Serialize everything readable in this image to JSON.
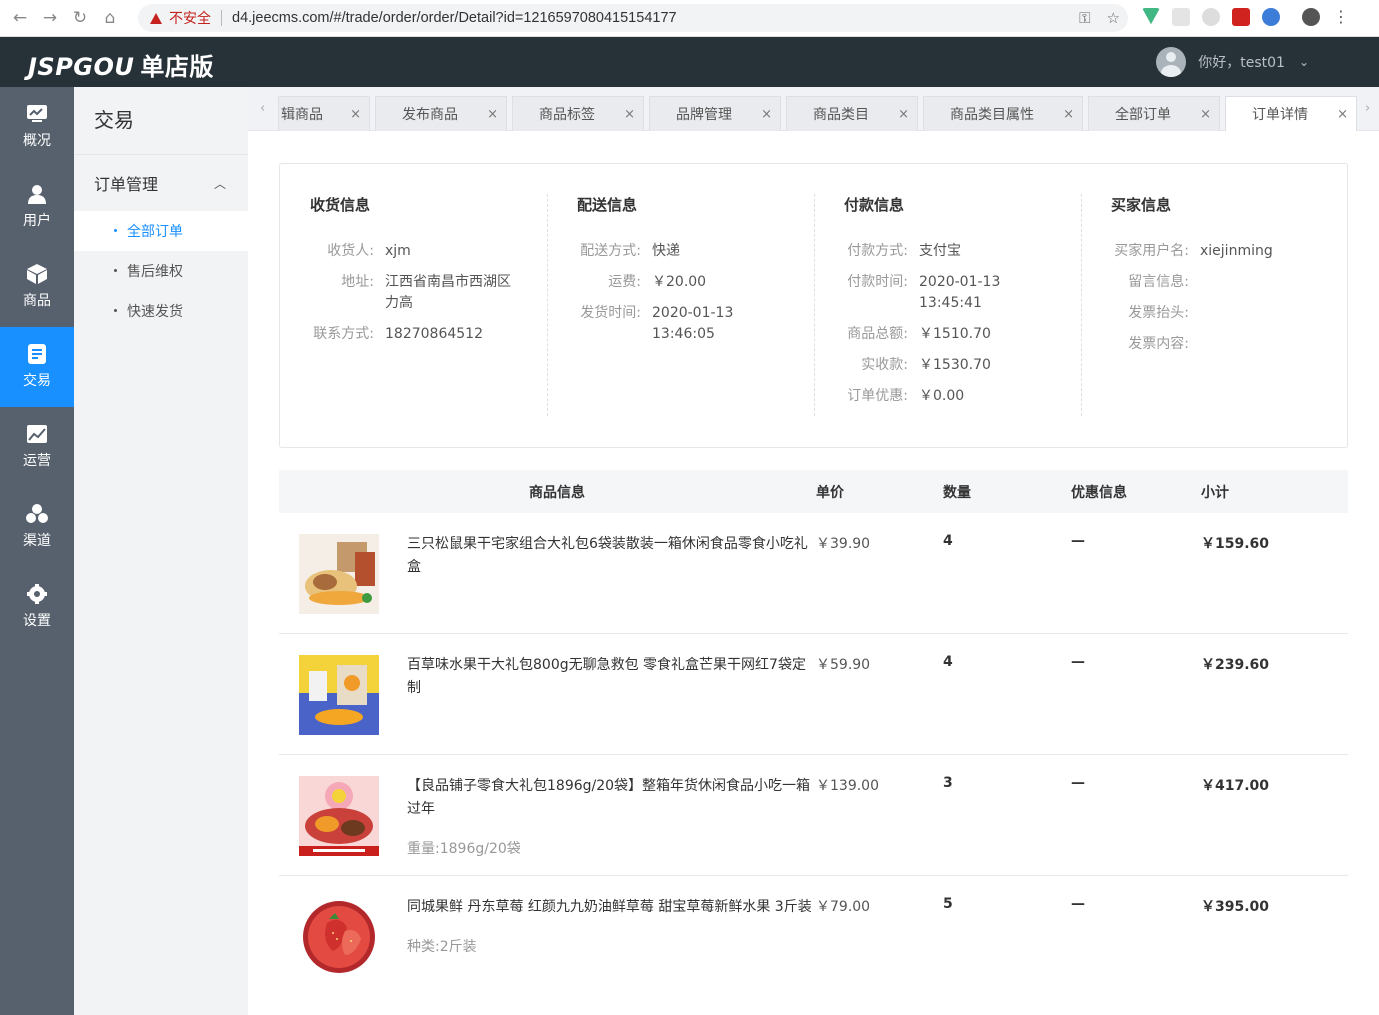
{
  "browser": {
    "insecure_label": "不安全",
    "url": "d4.jeecms.com/#/trade/order/order/Detail?id=1216597080415154177"
  },
  "header": {
    "logo": "JSPGOU",
    "logo_cn": "单店版",
    "greeting": "你好，test01"
  },
  "mainnav": [
    {
      "label": "概况",
      "icon": "dashboard-icon"
    },
    {
      "label": "用户",
      "icon": "user-icon"
    },
    {
      "label": "商品",
      "icon": "cube-icon"
    },
    {
      "label": "交易",
      "icon": "document-icon"
    },
    {
      "label": "运营",
      "icon": "chart-icon"
    },
    {
      "label": "渠道",
      "icon": "channels-icon"
    },
    {
      "label": "设置",
      "icon": "gear-icon"
    }
  ],
  "subnav": {
    "title": "交易",
    "group": "订单管理",
    "items": [
      "全部订单",
      "售后维权",
      "快速发货"
    ]
  },
  "tabs": [
    "辑商品",
    "发布商品",
    "商品标签",
    "品牌管理",
    "商品类目",
    "商品类目属性",
    "全部订单",
    "订单详情"
  ],
  "info": {
    "receive": {
      "title": "收货信息",
      "receiver_label": "收货人:",
      "receiver": "xjm",
      "address_label": "地址:",
      "address_line1": "江西省南昌市西湖区",
      "address_line2": "力高",
      "contact_label": "联系方式:",
      "contact": "18270864512"
    },
    "delivery": {
      "title": "配送信息",
      "method_label": "配送方式:",
      "method": "快递",
      "fee_label": "运费:",
      "fee": "￥20.00",
      "time_label": "发货时间:",
      "date": "2020-01-13",
      "time": "13:46:05"
    },
    "payment": {
      "title": "付款信息",
      "method_label": "付款方式:",
      "method": "支付宝",
      "time_label": "付款时间:",
      "date": "2020-01-13",
      "time": "13:45:41",
      "total_label": "商品总额:",
      "total": "￥1510.70",
      "paid_label": "实收款:",
      "paid": "￥1530.70",
      "discount_label": "订单优惠:",
      "discount": "￥0.00"
    },
    "buyer": {
      "title": "买家信息",
      "username_label": "买家用户名:",
      "username": "xiejinming",
      "message_label": "留言信息:",
      "invoice_title_label": "发票抬头:",
      "invoice_content_label": "发票内容:"
    }
  },
  "table": {
    "headers": {
      "product": "商品信息",
      "price": "单价",
      "qty": "数量",
      "discount": "优惠信息",
      "subtotal": "小计"
    },
    "rows": [
      {
        "name": "三只松鼠果干宅家组合大礼包6袋装散装一箱休闲食品零食小吃礼盒",
        "spec": "",
        "price": "￥39.90",
        "qty": "4",
        "discount": "—",
        "subtotal": "￥159.60"
      },
      {
        "name": "百草味水果干大礼包800g无聊急救包 零食礼盒芒果干网红7袋定制",
        "spec": "",
        "price": "￥59.90",
        "qty": "4",
        "discount": "—",
        "subtotal": "￥239.60"
      },
      {
        "name": "【良品铺子零食大礼包1896g/20袋】整箱年货休闲食品小吃一箱过年",
        "spec": "重量:1896g/20袋",
        "price": "￥139.00",
        "qty": "3",
        "discount": "—",
        "subtotal": "￥417.00"
      },
      {
        "name": "同城果鲜 丹东草莓 红颜九九奶油鲜草莓 甜宝草莓新鲜水果 3斤装",
        "spec": "种类:2斤装",
        "price": "￥79.00",
        "qty": "5",
        "discount": "—",
        "subtotal": "￥395.00"
      }
    ]
  }
}
